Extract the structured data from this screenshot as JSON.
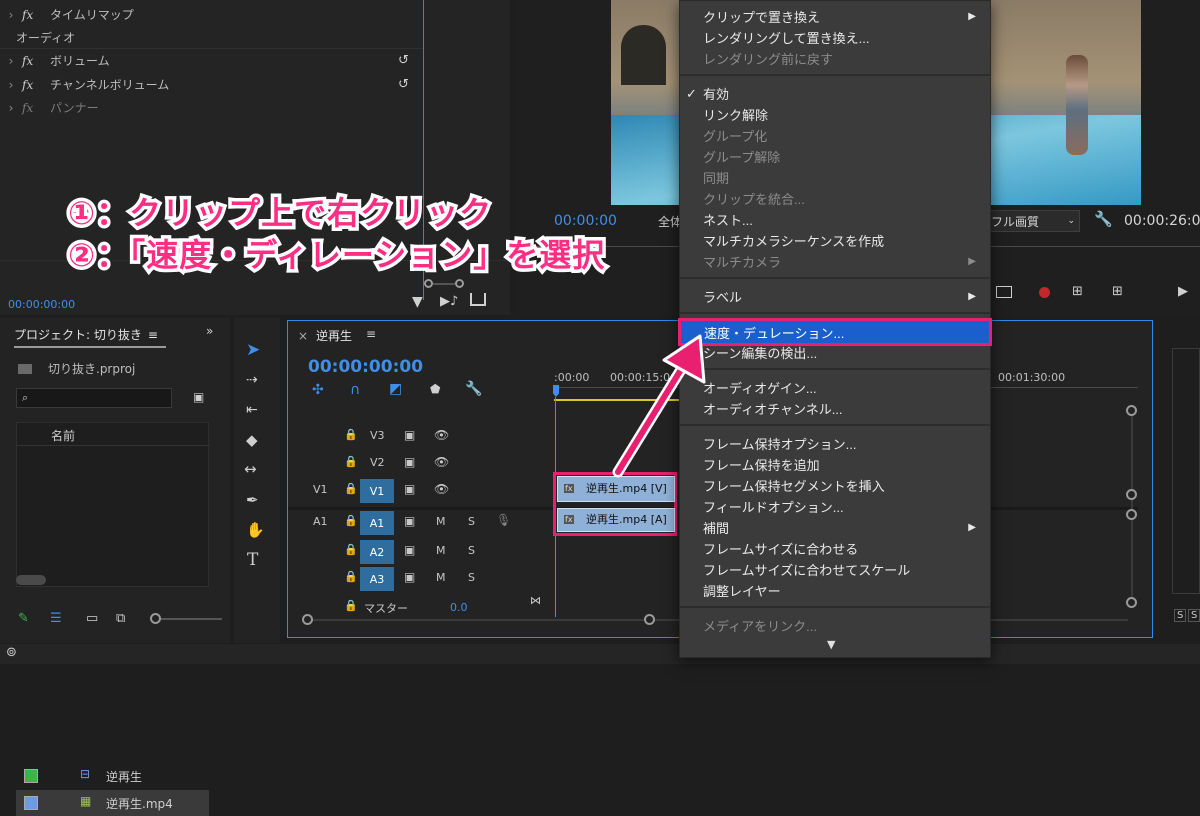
{
  "effect_controls": {
    "rows": [
      {
        "label": "タイムリマップ",
        "dim": false,
        "fx": true,
        "reset": false
      },
      {
        "label": "オーディオ",
        "dim": false,
        "fx": false,
        "header": true,
        "reset": false
      },
      {
        "label": "ボリューム",
        "dim": false,
        "fx": true,
        "reset": true
      },
      {
        "label": "チャンネルボリューム",
        "dim": false,
        "fx": true,
        "reset": true
      },
      {
        "label": "パンナー",
        "dim": true,
        "fx": true,
        "reset": false
      }
    ],
    "fx_label": "fx",
    "timecode": "00:00:00:00"
  },
  "annotation": {
    "line1": "①：クリップ上で右クリック",
    "line2": "②：「速度・ディレーション」を選択"
  },
  "program_monitor": {
    "timecode_left": "00:00:00",
    "fit_label": "全体",
    "quality": "フル画質",
    "timecode_right": "00:00:26:0"
  },
  "project": {
    "title": "プロジェクト: 切り抜き",
    "file": "切り抜き.prproj",
    "search_placeholder": "",
    "col_name": "名前",
    "items": [
      {
        "name": "逆再生",
        "color": "#3db34a"
      },
      {
        "name": "逆再生.mp4",
        "color": "#6d9be0"
      }
    ]
  },
  "timeline": {
    "tab": "逆再生",
    "timecode": "00:00:00:00",
    "ruler": [
      ":00:00",
      "00:00:15:00",
      "00:01:30:00"
    ],
    "video_tracks": [
      "V3",
      "V2",
      "V1"
    ],
    "audio_tracks": [
      "A1",
      "A2",
      "A3"
    ],
    "source_v": "V1",
    "source_a": "A1",
    "mute": "M",
    "solo": "S",
    "master": "マスター",
    "master_value": "0.0",
    "clip_video": "逆再生.mp4 [V]",
    "clip_audio": "逆再生.mp4 [A]",
    "fx_badge": "fx"
  },
  "context_menu": {
    "items": [
      {
        "label": "クリップで置き換え",
        "state": "normal",
        "submenu": true
      },
      {
        "label": "レンダリングして置き換え...",
        "state": "normal"
      },
      {
        "label": "レンダリング前に戻す",
        "state": "disabled"
      },
      {
        "sep": true
      },
      {
        "label": "有効",
        "state": "normal",
        "checked": true
      },
      {
        "label": "リンク解除",
        "state": "normal"
      },
      {
        "label": "グループ化",
        "state": "disabled"
      },
      {
        "label": "グループ解除",
        "state": "disabled"
      },
      {
        "label": "同期",
        "state": "disabled"
      },
      {
        "label": "クリップを統合...",
        "state": "disabled"
      },
      {
        "label": "ネスト...",
        "state": "normal"
      },
      {
        "label": "マルチカメラシーケンスを作成",
        "state": "normal"
      },
      {
        "label": "マルチカメラ",
        "state": "disabled",
        "submenu": true
      },
      {
        "sep": true
      },
      {
        "label": "ラベル",
        "state": "normal",
        "submenu": true
      },
      {
        "sep": true
      },
      {
        "label": "速度・デュレーション...",
        "state": "highlighted"
      },
      {
        "label": "シーン編集の検出...",
        "state": "normal"
      },
      {
        "sep": true
      },
      {
        "label": "オーディオゲイン...",
        "state": "normal"
      },
      {
        "label": "オーディオチャンネル...",
        "state": "normal"
      },
      {
        "sep": true
      },
      {
        "label": "フレーム保持オプション...",
        "state": "normal"
      },
      {
        "label": "フレーム保持を追加",
        "state": "normal"
      },
      {
        "label": "フレーム保持セグメントを挿入",
        "state": "normal"
      },
      {
        "label": "フィールドオプション...",
        "state": "normal"
      },
      {
        "label": "補間",
        "state": "normal",
        "submenu": true
      },
      {
        "label": "フレームサイズに合わせる",
        "state": "normal"
      },
      {
        "label": "フレームサイズに合わせてスケール",
        "state": "normal"
      },
      {
        "label": "調整レイヤー",
        "state": "normal"
      },
      {
        "sep": true
      },
      {
        "label": "メディアをリンク...",
        "state": "disabled"
      }
    ],
    "more_arrow": "▼",
    "check_glyph": "✓",
    "submenu_glyph": "▶"
  },
  "right_meters": {
    "s1": "S",
    "s2": "S"
  },
  "colors": {
    "accent_blue": "#2d8ceb",
    "highlight_pink": "#e8206f",
    "menu_highlight": "#1a5fcc"
  }
}
